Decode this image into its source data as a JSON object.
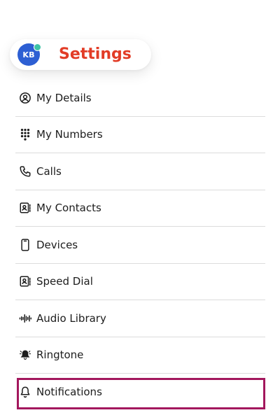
{
  "header": {
    "avatar_initials": "KB",
    "title": "Settings",
    "title_color": "#e23c26",
    "avatar_color": "#2d5fd3",
    "status_color": "#3ec3a6"
  },
  "menu": {
    "items": [
      {
        "label": "My Details",
        "icon": "user-circle-icon"
      },
      {
        "label": "My Numbers",
        "icon": "dialpad-icon"
      },
      {
        "label": "Calls",
        "icon": "phone-icon"
      },
      {
        "label": "My Contacts",
        "icon": "contact-book-icon"
      },
      {
        "label": "Devices",
        "icon": "mobile-device-icon"
      },
      {
        "label": "Speed Dial",
        "icon": "contact-book-icon"
      },
      {
        "label": "Audio Library",
        "icon": "audio-wave-icon"
      },
      {
        "label": "Ringtone",
        "icon": "ringing-bell-icon"
      },
      {
        "label": "Notifications",
        "icon": "bell-icon"
      }
    ],
    "highlight_color": "#a3175d",
    "highlighted_item": "Notifications"
  }
}
